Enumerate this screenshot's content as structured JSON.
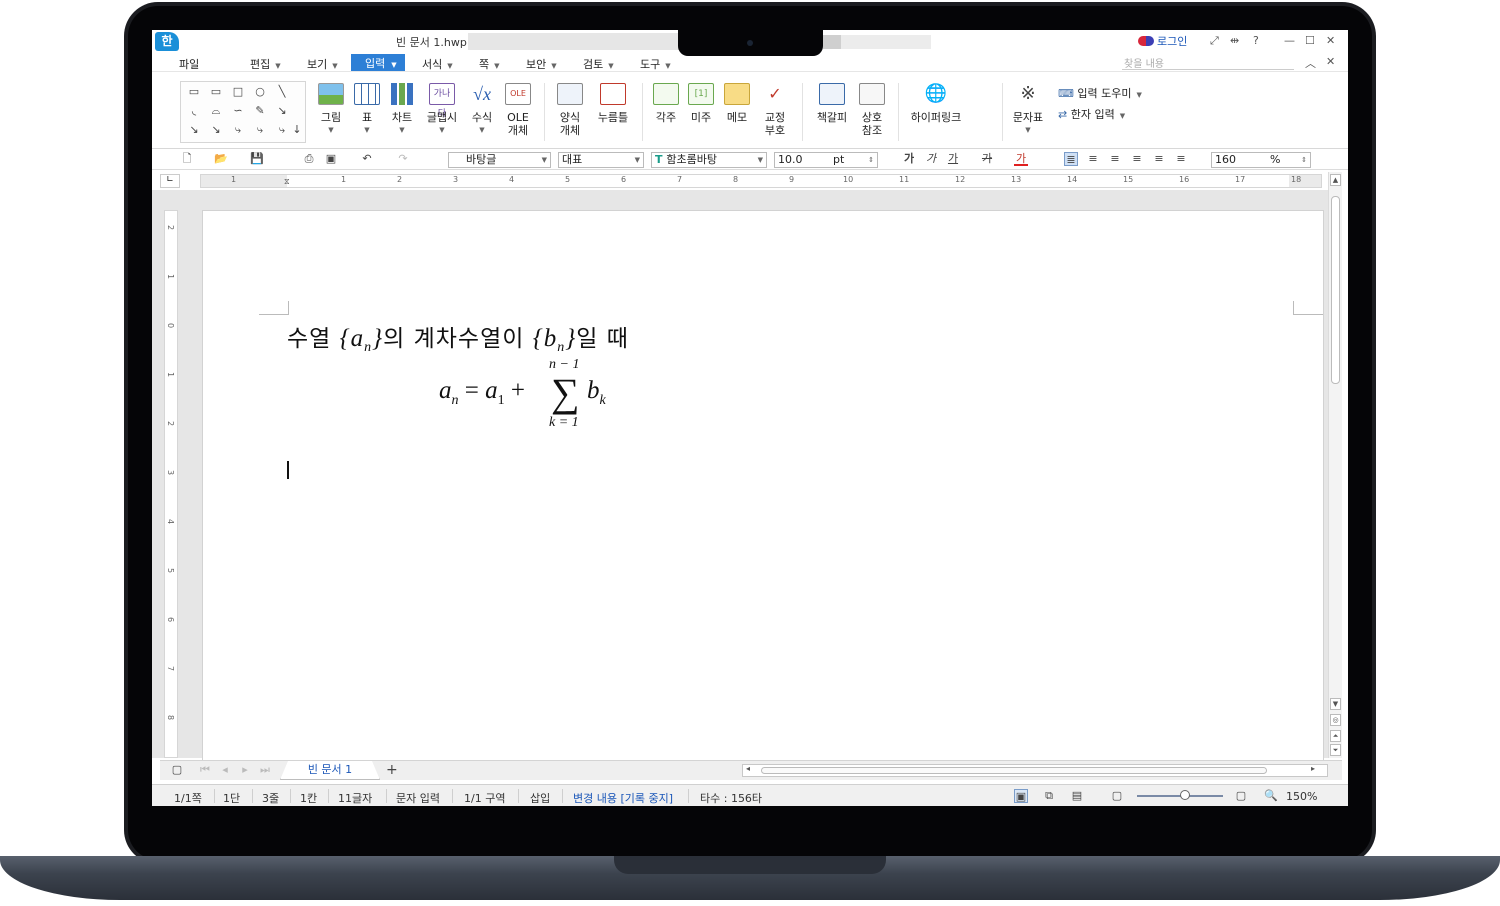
{
  "titlebar": {
    "app_logo": "한",
    "doc_title": "빈 문서 1.hwp",
    "login_label": "로그인",
    "help_label": "?"
  },
  "menu": {
    "items": [
      "파일",
      "편집",
      "보기",
      "입력",
      "서식",
      "쪽",
      "보안",
      "검토",
      "도구"
    ],
    "active": "입력",
    "search_placeholder": "찾을 내용"
  },
  "ribbon": {
    "picture": "그림",
    "table": "표",
    "chart": "차트",
    "glyph": "글맵시",
    "equation": "수식",
    "ole_top": "OLE",
    "ole_bottom": "개체",
    "form_top": "양식",
    "form_bottom": "개체",
    "button": "누름틀",
    "footnote": "각주",
    "endnote": "미주",
    "memo": "메모",
    "proof_top": "교정",
    "proof_bottom": "부호",
    "bookmark": "책갈피",
    "xref_top": "상호",
    "xref_bottom": "참조",
    "hyperlink": "하이퍼링크",
    "charmap": "문자표",
    "input_helper": "입력 도우미",
    "hanja_input": "한자 입력"
  },
  "toolbar": {
    "style": "바탕글",
    "lang": "대표",
    "font": "함초롬바탕",
    "size": "10.0",
    "unit": "pt",
    "bold_label": "가",
    "italic_label": "가",
    "underline_label": "가",
    "strike_label": "가",
    "color_label": "가",
    "zoom": "160",
    "zoom_unit": "%"
  },
  "ruler": {
    "numbers": [
      "1",
      "1",
      "2",
      "3",
      "4",
      "5",
      "6",
      "7",
      "8",
      "9",
      "10",
      "11",
      "12",
      "13",
      "14",
      "15",
      "16",
      "17",
      "18"
    ],
    "vnumbers": [
      "2",
      "1",
      "0",
      "1",
      "2",
      "3",
      "4",
      "5",
      "6",
      "7",
      "8"
    ]
  },
  "document": {
    "line1_text_a": "수열",
    "line1_seq_a": "a",
    "line1_sub_n": "n",
    "line1_text_b": "의  계차수열이",
    "line1_seq_b": "b",
    "line1_sub_n2": "n",
    "line1_text_c": "일  때",
    "formula_lhs": "a",
    "formula_lhs_sub": "n",
    "formula_eq": " = ",
    "formula_a1": "a",
    "formula_a1_sub": "1",
    "formula_plus": " +",
    "formula_sigma": "∑",
    "formula_upper": "n − 1",
    "formula_lower": "k = 1",
    "formula_b": "b",
    "formula_b_sub": "k"
  },
  "tabs": {
    "doc_tab": "빈 문서 1",
    "add_label": "+"
  },
  "status": {
    "page": "1/1쪽",
    "column": "1단",
    "line": "3줄",
    "col": "1칸",
    "chars": "11글자",
    "mode": "문자 입력",
    "section": "1/1 구역",
    "insert": "삽입",
    "track_changes": "변경 내용 [기록 중지]",
    "keystrokes": "타수 : 156타",
    "zoom": "150%"
  }
}
